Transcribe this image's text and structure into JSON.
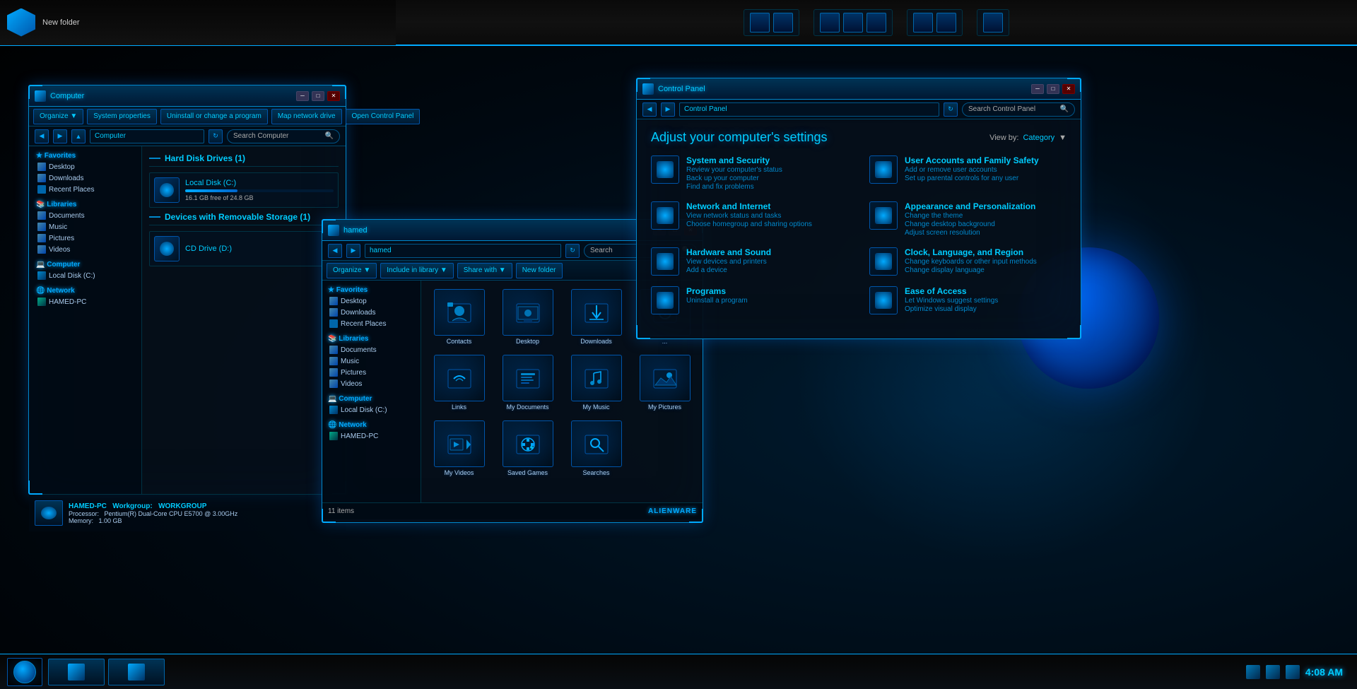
{
  "taskbar": {
    "top": {
      "label": "New folder"
    },
    "bottom": {
      "clock": "4:08 AM"
    }
  },
  "computer_window": {
    "title": "Computer",
    "search_placeholder": "Search Computer",
    "toolbar": {
      "organize": "Organize ▼",
      "system_properties": "System properties",
      "uninstall": "Uninstall or change a program",
      "map_drive": "Map network drive",
      "open_control_panel": "Open Control Panel"
    },
    "sidebar": {
      "favorites_label": "Favorites",
      "favorites_items": [
        "Desktop",
        "Downloads",
        "Recent Places"
      ],
      "libraries_label": "Libraries",
      "libraries_items": [
        "Documents",
        "Music",
        "Pictures",
        "Videos"
      ],
      "computer_label": "Computer",
      "computer_items": [
        "Local Disk (C:)"
      ],
      "network_label": "Network",
      "network_items": [
        "HAMED-PC"
      ]
    },
    "hard_disk_drives": {
      "section_title": "Hard Disk Drives (1)",
      "drive_name": "Local Disk (C:)",
      "drive_free": "16.1 GB free of 24.8 GB",
      "drive_fill_pct": 35
    },
    "removable": {
      "section_title": "Devices with Removable Storage (1)",
      "drive_name": "CD Drive (D:)"
    },
    "pc_info": {
      "name": "HAMED-PC",
      "workgroup_label": "Workgroup:",
      "workgroup": "WORKGROUP",
      "processor_label": "Processor:",
      "processor": "Pentium(R) Dual-Core CPU  E5700 @ 3.00GHz",
      "memory_label": "Memory:",
      "memory": "1.00 GB"
    }
  },
  "explorer_window": {
    "title": "hamed",
    "search_label": "Search",
    "toolbar": {
      "organize": "Organize ▼",
      "include_library": "Include in library ▼",
      "share_with": "Share with ▼",
      "new_folder": "New folder"
    },
    "sidebar": {
      "favorites_label": "Favorites",
      "favorites_items": [
        "Desktop",
        "Downloads",
        "Recent Places"
      ],
      "libraries_label": "Libraries",
      "libraries_items": [
        "Documents",
        "Music",
        "Pictures",
        "Videos"
      ],
      "computer_label": "Computer",
      "computer_items": [
        "Local Disk (C:)"
      ],
      "network_label": "Network",
      "network_items": [
        "HAMED-PC"
      ]
    },
    "folders": [
      "Contacts",
      "Desktop",
      "Downloads",
      "...",
      "Links",
      "My Documents",
      "My Music",
      "My Pictures",
      "My Videos",
      "Saved Games",
      "Searches"
    ],
    "status": "11 items",
    "badge": "ALIENWARE"
  },
  "control_panel": {
    "title": "Control Panel",
    "search_placeholder": "Search Control Panel",
    "heading": "Adjust your computer's settings",
    "view_by_label": "View by:",
    "view_by_value": "Category",
    "categories": [
      {
        "name": "System and Security",
        "links": [
          "Review your computer's status",
          "Back up your computer",
          "Find and fix problems"
        ]
      },
      {
        "name": "User Accounts and Family Safety",
        "links": [
          "Add or remove user accounts",
          "Set up parental controls for any user"
        ]
      },
      {
        "name": "Network and Internet",
        "links": [
          "View network status and tasks",
          "Choose homegroup and sharing options"
        ]
      },
      {
        "name": "Appearance and Personalization",
        "links": [
          "Change the theme",
          "Change desktop background",
          "Adjust screen resolution"
        ]
      },
      {
        "name": "Hardware and Sound",
        "links": [
          "View devices and printers",
          "Add a device"
        ]
      },
      {
        "name": "Clock, Language, and Region",
        "links": [
          "Change keyboards or other input methods",
          "Change display language"
        ]
      },
      {
        "name": "Programs",
        "links": [
          "Uninstall a program"
        ]
      },
      {
        "name": "Ease of Access",
        "links": [
          "Let Windows suggest settings",
          "Optimize visual display"
        ]
      }
    ]
  }
}
